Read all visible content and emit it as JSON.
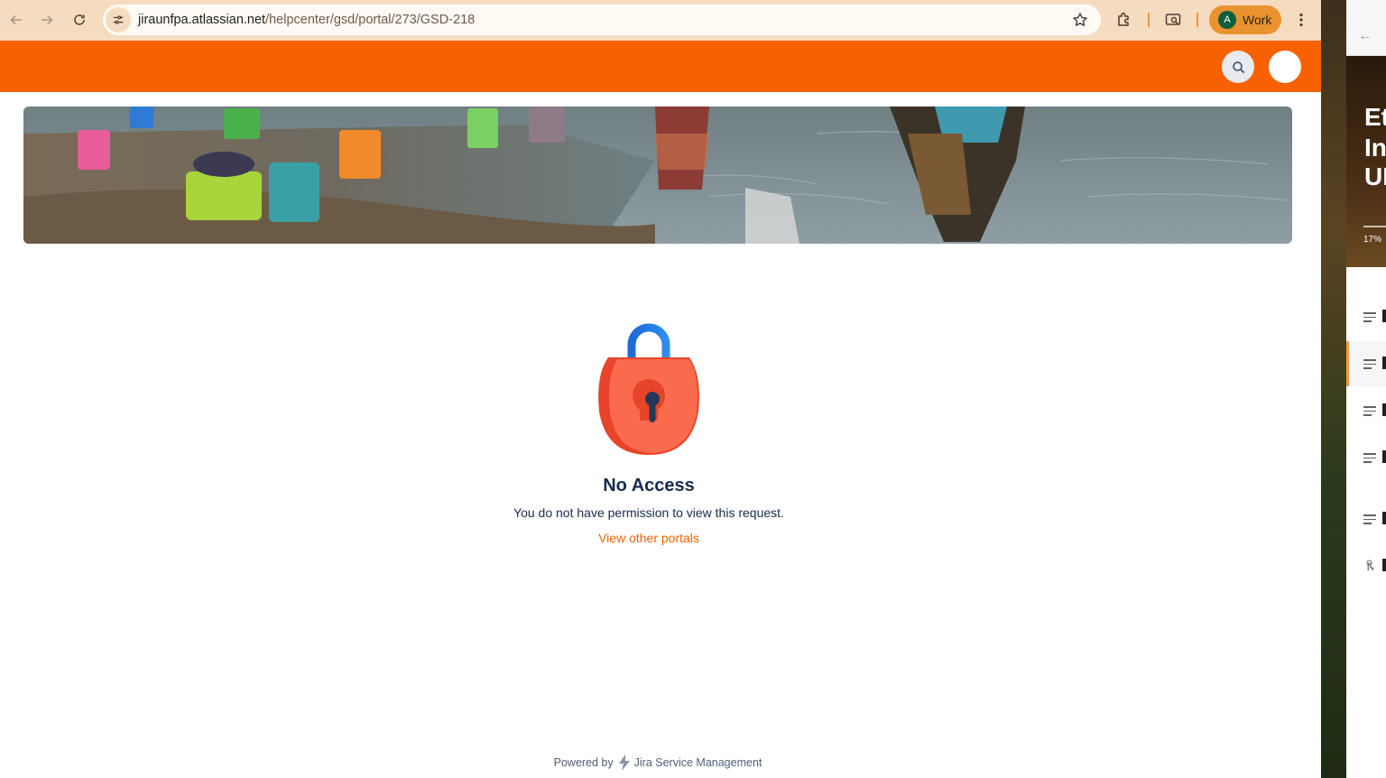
{
  "browser": {
    "url_host": "jiraunfpa.atlassian.net",
    "url_path": "/helpcenter/gsd/portal/273/GSD-218",
    "profile_initial": "A",
    "profile_label": "Work",
    "icons": [
      "back-arrow-icon",
      "forward-arrow-icon",
      "reload-icon",
      "site-settings-icon",
      "star-icon",
      "extensions-icon",
      "cast-icon",
      "more-vert-icon"
    ]
  },
  "portal": {
    "brand_color": "#f76101",
    "header_icons": [
      "search-icon",
      "user-avatar"
    ]
  },
  "main": {
    "icon": "lock-icon",
    "title": "No Access",
    "message": "You do not have permission to view this request.",
    "link_label": "View other portals"
  },
  "footer": {
    "powered_by": "Powered by",
    "product": "Jira Service Management",
    "icon": "jira-service-management-logo"
  },
  "side_panel": {
    "hero_text": [
      "Et",
      "In",
      "UI"
    ],
    "progress_label": "17%",
    "progress": 0.17,
    "item_cut_text": [
      "I",
      "I",
      "I",
      "A",
      "V",
      "S"
    ]
  }
}
